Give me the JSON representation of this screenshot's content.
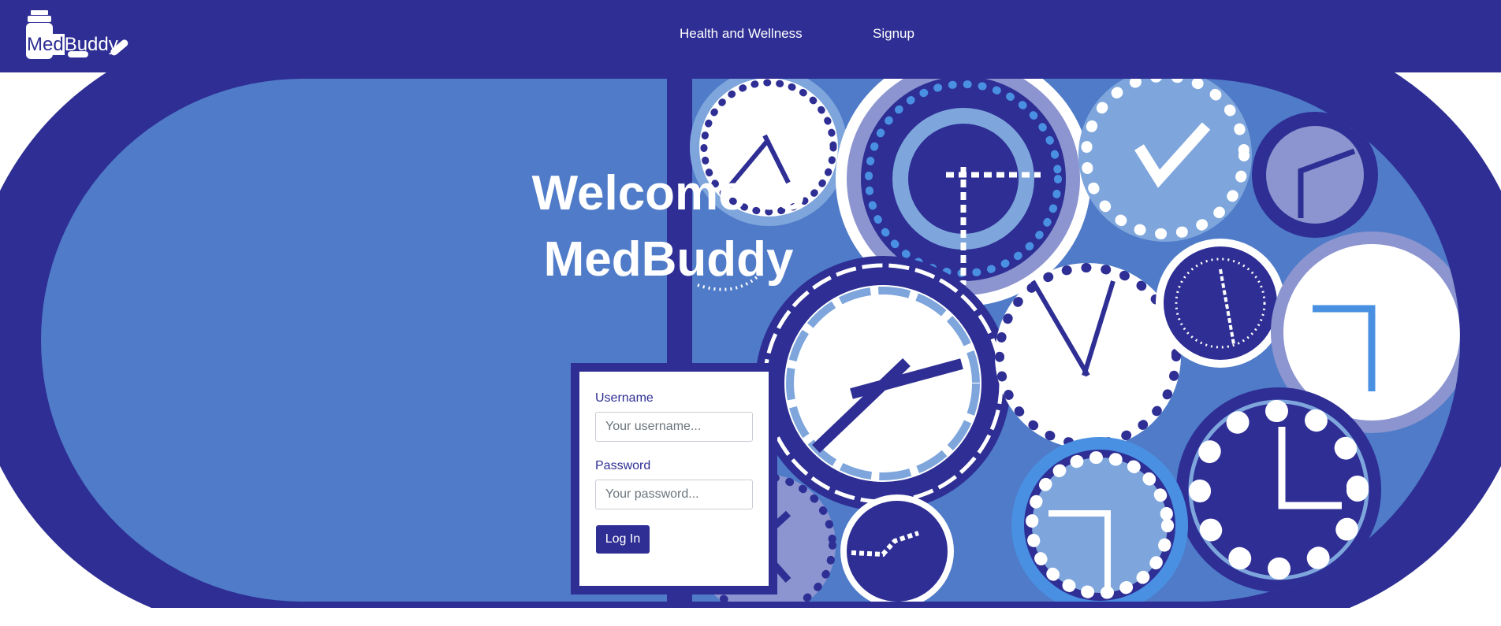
{
  "brand": {
    "name_part1": "Med",
    "name_part2": "Buddy"
  },
  "nav": {
    "links": [
      {
        "label": "Health and Wellness"
      },
      {
        "label": "Signup"
      }
    ]
  },
  "hero": {
    "title_line1": "Welcome to",
    "title_line2": "MedBuddy",
    "illustration": "pill-with-clocks-illustration"
  },
  "login": {
    "username_label": "Username",
    "username_placeholder": "Your username...",
    "password_label": "Password",
    "password_placeholder": "Your password...",
    "submit_label": "Log In"
  },
  "colors": {
    "primary": "#2e2e94",
    "hero_blue": "#4f7bc8",
    "light_blue": "#7ea6dc",
    "lavender": "#8c95cf",
    "white": "#ffffff"
  }
}
